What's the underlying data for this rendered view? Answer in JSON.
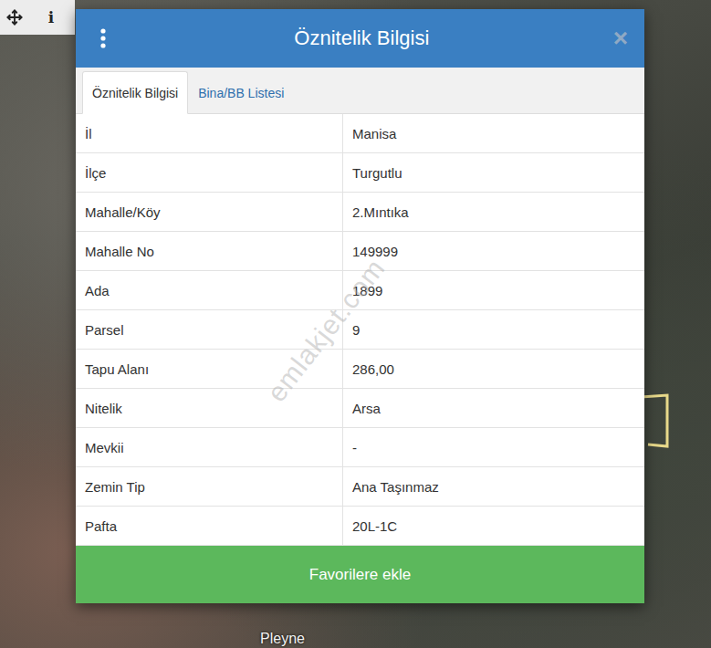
{
  "toolbar": {
    "info_label": "i"
  },
  "map": {
    "street_label": "Pleyne",
    "watermark": "emlakjet.com"
  },
  "dialog": {
    "title": "Öznitelik Bilgisi",
    "close": "×",
    "tabs": [
      {
        "label": "Öznitelik Bilgisi",
        "selected": true
      },
      {
        "label": "Bina/BB Listesi",
        "selected": false
      }
    ],
    "rows": [
      {
        "label": "İl",
        "value": "Manisa"
      },
      {
        "label": "İlçe",
        "value": "Turgutlu"
      },
      {
        "label": "Mahalle/Köy",
        "value": "2.Mıntıka"
      },
      {
        "label": "Mahalle No",
        "value": "149999"
      },
      {
        "label": "Ada",
        "value": "1899"
      },
      {
        "label": "Parsel",
        "value": "9"
      },
      {
        "label": "Tapu Alanı",
        "value": "286,00"
      },
      {
        "label": "Nitelik",
        "value": "Arsa"
      },
      {
        "label": "Mevkii",
        "value": "-"
      },
      {
        "label": "Zemin Tip",
        "value": "Ana Taşınmaz"
      },
      {
        "label": "Pafta",
        "value": "20L-1C"
      }
    ],
    "button": "Favorilere ekle"
  }
}
